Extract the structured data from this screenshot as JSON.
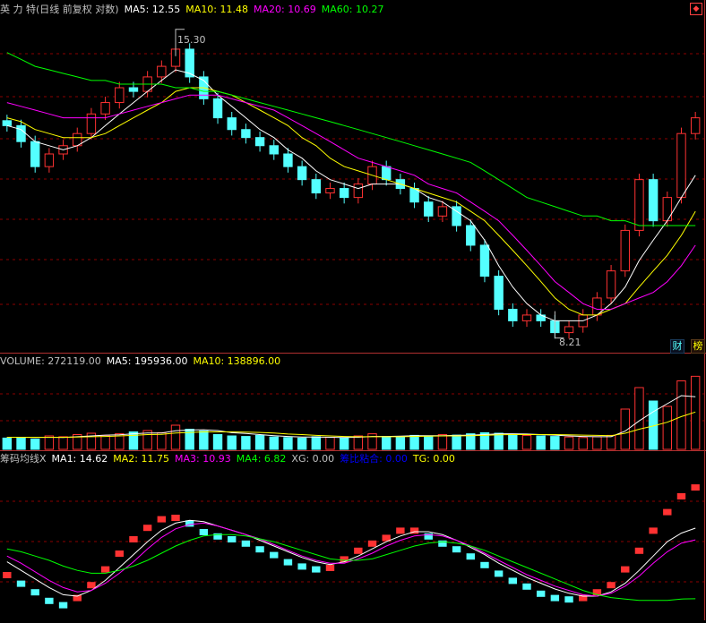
{
  "price_panel": {
    "title": "英 力 特(日线 前复权 对数)",
    "ma5_label": "MA5: 12.55",
    "ma10_label": "MA10: 11.48",
    "ma20_label": "MA20: 10.69",
    "ma60_label": "MA60: 10.27",
    "high_marker": "15.30",
    "low_marker": "8.21",
    "btn_cai": "财",
    "btn_bang": "榜"
  },
  "volume_panel": {
    "vol_label": "VOLUME: 272119.00",
    "ma5_label": "MA5: 195936.00",
    "ma10_label": "MA10: 138896.00"
  },
  "chip_panel": {
    "title": "筹码均线X",
    "ma1_label": "MA1: 14.62",
    "ma2_label": "MA2: 11.75",
    "ma3_label": "MA3: 10.93",
    "ma4_label": "MA4: 6.82",
    "xg_label": "XG: 0.00",
    "jbzh_label": "筹比粘合: 0.00",
    "tg_label": "TG: 0.00"
  },
  "colors": {
    "up": "#ff3232",
    "down": "#54ffff",
    "ma5": "#ffffff",
    "ma10": "#ffff00",
    "ma20": "#ff00ff",
    "ma60": "#00ff00",
    "grid": "#8b0000",
    "text": "#c0c0c0",
    "blue": "#0000ff"
  },
  "chart_data": [
    {
      "type": "candlestick",
      "title": "英 力 特(日线 前复权 对数)",
      "ylim": [
        8.0,
        15.6
      ],
      "y_scale": "log",
      "annotations": [
        {
          "label": "15.30",
          "value": 15.3
        },
        {
          "label": "8.21",
          "value": 8.21
        }
      ],
      "close": [
        12.6,
        12.2,
        11.6,
        11.9,
        12.1,
        12.4,
        12.9,
        13.2,
        13.6,
        13.5,
        13.9,
        14.2,
        14.7,
        13.9,
        13.3,
        12.8,
        12.5,
        12.3,
        12.1,
        11.9,
        11.6,
        11.3,
        11.0,
        11.1,
        10.9,
        11.2,
        11.6,
        11.3,
        11.1,
        10.8,
        10.5,
        10.7,
        10.3,
        9.9,
        9.3,
        8.7,
        8.5,
        8.6,
        8.5,
        8.3,
        8.4,
        8.6,
        8.9,
        9.4,
        10.2,
        11.3,
        10.4,
        10.9,
        12.4,
        12.8
      ],
      "series": [
        {
          "name": "MA5",
          "values": [
            12.6,
            12.5,
            12.2,
            12.1,
            12.0,
            12.1,
            12.3,
            12.6,
            12.9,
            13.2,
            13.5,
            13.8,
            14.1,
            14.0,
            13.8,
            13.4,
            13.1,
            12.8,
            12.5,
            12.3,
            12.0,
            11.8,
            11.5,
            11.3,
            11.2,
            11.1,
            11.2,
            11.2,
            11.2,
            11.1,
            10.9,
            10.8,
            10.6,
            10.4,
            10.0,
            9.5,
            9.1,
            8.8,
            8.6,
            8.5,
            8.5,
            8.5,
            8.6,
            8.8,
            9.1,
            9.6,
            10.0,
            10.4,
            10.9,
            11.4
          ]
        },
        {
          "name": "MA10",
          "values": [
            12.8,
            12.7,
            12.5,
            12.4,
            12.3,
            12.3,
            12.3,
            12.4,
            12.6,
            12.8,
            13.0,
            13.2,
            13.5,
            13.6,
            13.6,
            13.5,
            13.4,
            13.2,
            13.0,
            12.8,
            12.6,
            12.3,
            12.1,
            11.8,
            11.6,
            11.5,
            11.4,
            11.3,
            11.2,
            11.1,
            11.0,
            10.9,
            10.8,
            10.6,
            10.4,
            10.1,
            9.8,
            9.5,
            9.2,
            8.9,
            8.7,
            8.6,
            8.6,
            8.7,
            8.8,
            9.1,
            9.4,
            9.7,
            10.1,
            10.6
          ]
        },
        {
          "name": "MA20",
          "values": [
            13.2,
            13.1,
            13.0,
            12.9,
            12.8,
            12.8,
            12.8,
            12.8,
            12.9,
            13.0,
            13.1,
            13.2,
            13.3,
            13.4,
            13.4,
            13.4,
            13.3,
            13.2,
            13.1,
            13.0,
            12.8,
            12.6,
            12.4,
            12.2,
            12.0,
            11.8,
            11.7,
            11.6,
            11.5,
            11.4,
            11.2,
            11.1,
            11.0,
            10.8,
            10.6,
            10.4,
            10.1,
            9.8,
            9.5,
            9.2,
            9.0,
            8.8,
            8.7,
            8.7,
            8.8,
            8.9,
            9.0,
            9.2,
            9.5,
            9.9
          ]
        },
        {
          "name": "MA60",
          "values": [
            14.6,
            14.4,
            14.2,
            14.1,
            14.0,
            13.9,
            13.8,
            13.8,
            13.7,
            13.7,
            13.7,
            13.7,
            13.6,
            13.6,
            13.5,
            13.5,
            13.4,
            13.3,
            13.2,
            13.1,
            13.0,
            12.9,
            12.8,
            12.7,
            12.6,
            12.5,
            12.4,
            12.3,
            12.2,
            12.1,
            12.0,
            11.9,
            11.8,
            11.7,
            11.5,
            11.3,
            11.1,
            10.9,
            10.8,
            10.7,
            10.6,
            10.5,
            10.5,
            10.4,
            10.4,
            10.3,
            10.3,
            10.3,
            10.3,
            10.3
          ]
        }
      ]
    },
    {
      "type": "bar",
      "title": "VOLUME",
      "ylim": [
        0,
        300000
      ],
      "values": [
        42000,
        45000,
        38000,
        50000,
        47000,
        55000,
        60000,
        52000,
        58000,
        65000,
        70000,
        62000,
        90000,
        75000,
        68000,
        55000,
        50000,
        48000,
        52000,
        46000,
        44000,
        42000,
        47000,
        45000,
        43000,
        50000,
        58000,
        48000,
        46000,
        52000,
        49000,
        55000,
        53000,
        58000,
        62000,
        60000,
        55000,
        52000,
        50000,
        48000,
        46000,
        44000,
        47000,
        52000,
        150000,
        230000,
        180000,
        160000,
        255000,
        272119
      ],
      "series": [
        {
          "name": "MA5",
          "values": [
            45000,
            45000,
            44000,
            45000,
            44000,
            47000,
            50000,
            53000,
            54000,
            58000,
            61000,
            61000,
            69000,
            72000,
            73000,
            70000,
            62000,
            59000,
            55000,
            51000,
            48000,
            46000,
            46000,
            45000,
            44000,
            45000,
            48000,
            48000,
            49000,
            51000,
            51000,
            51000,
            52000,
            53000,
            55000,
            58000,
            58000,
            57000,
            55000,
            53000,
            50000,
            48000,
            47000,
            47000,
            68000,
            106000,
            140000,
            170000,
            200000,
            195936
          ]
        },
        {
          "name": "MA10",
          "values": [
            45000,
            45000,
            45000,
            45000,
            45000,
            46000,
            47000,
            48000,
            50000,
            52000,
            55000,
            56000,
            61000,
            63000,
            65000,
            65000,
            65000,
            64000,
            63000,
            61000,
            57000,
            55000,
            52000,
            50000,
            48000,
            47000,
            47000,
            47000,
            47000,
            48000,
            49000,
            50000,
            50000,
            51000,
            52000,
            54000,
            55000,
            55000,
            55000,
            55000,
            54000,
            53000,
            52000,
            51000,
            60000,
            75000,
            87000,
            101000,
            122000,
            138896
          ]
        }
      ]
    },
    {
      "type": "line",
      "title": "筹码均线X",
      "ylim": [
        5.5,
        16.0
      ],
      "series": [
        {
          "name": "MA1",
          "values": [
            8.5,
            7.9,
            7.3,
            6.7,
            6.4,
            6.9,
            7.8,
            8.9,
            10.0,
            11.0,
            11.8,
            12.4,
            12.5,
            12.1,
            11.5,
            11.2,
            11.0,
            10.7,
            10.3,
            9.9,
            9.4,
            9.1,
            8.9,
            9.0,
            9.6,
            10.2,
            10.7,
            11.1,
            11.6,
            11.6,
            11.2,
            10.7,
            10.3,
            9.8,
            9.2,
            8.6,
            8.1,
            7.7,
            7.2,
            6.9,
            6.8,
            6.9,
            7.3,
            7.8,
            8.9,
            10.2,
            11.6,
            12.9,
            14.0,
            14.62
          ]
        },
        {
          "name": "MA2",
          "values": [
            9.4,
            8.8,
            8.2,
            7.6,
            7.1,
            7.0,
            7.4,
            8.1,
            9.0,
            9.9,
            10.8,
            11.6,
            12.1,
            12.3,
            12.2,
            11.9,
            11.6,
            11.3,
            10.9,
            10.5,
            10.1,
            9.7,
            9.4,
            9.2,
            9.4,
            9.8,
            10.3,
            10.8,
            11.2,
            11.5,
            11.5,
            11.3,
            10.9,
            10.4,
            9.9,
            9.3,
            8.8,
            8.3,
            7.9,
            7.5,
            7.2,
            7.0,
            7.0,
            7.3,
            7.9,
            8.8,
            9.8,
            10.8,
            11.4,
            11.75
          ]
        },
        {
          "name": "MA3",
          "values": [
            9.8,
            9.3,
            8.7,
            8.1,
            7.6,
            7.3,
            7.4,
            7.9,
            8.6,
            9.4,
            10.3,
            11.1,
            11.7,
            12.0,
            12.1,
            11.9,
            11.6,
            11.3,
            11.0,
            10.6,
            10.2,
            9.8,
            9.5,
            9.3,
            9.3,
            9.6,
            10.0,
            10.5,
            10.9,
            11.2,
            11.3,
            11.2,
            10.9,
            10.5,
            10.0,
            9.5,
            9.0,
            8.5,
            8.1,
            7.7,
            7.4,
            7.1,
            7.0,
            7.2,
            7.7,
            8.4,
            9.3,
            10.1,
            10.7,
            10.93
          ]
        },
        {
          "name": "MA4",
          "values": [
            10.3,
            10.1,
            9.8,
            9.5,
            9.1,
            8.8,
            8.6,
            8.6,
            8.8,
            9.1,
            9.5,
            10.0,
            10.5,
            10.9,
            11.2,
            11.3,
            11.3,
            11.2,
            11.0,
            10.8,
            10.5,
            10.2,
            9.9,
            9.6,
            9.5,
            9.5,
            9.6,
            9.9,
            10.2,
            10.5,
            10.7,
            10.8,
            10.7,
            10.5,
            10.2,
            9.8,
            9.4,
            9.0,
            8.6,
            8.2,
            7.8,
            7.4,
            7.1,
            6.9,
            6.8,
            6.7,
            6.7,
            6.7,
            6.8,
            6.82
          ]
        }
      ]
    }
  ]
}
